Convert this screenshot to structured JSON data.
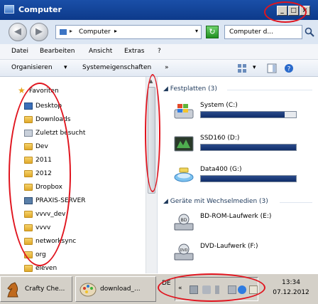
{
  "window": {
    "title": "Computer",
    "buttons": [
      "_",
      "□",
      "×"
    ]
  },
  "address": {
    "path": "Computer",
    "chevron": "▸",
    "search_value": "Computer d..."
  },
  "menu": [
    "Datei",
    "Bearbeiten",
    "Ansicht",
    "Extras",
    "?"
  ],
  "commands": {
    "organize": "Organisieren",
    "organize_arrow": "▾",
    "system_props": "Systemeigenschaften",
    "more": "»"
  },
  "nav": {
    "favorites_label": "Favoriten",
    "items": [
      {
        "label": "Desktop",
        "icon": "desktop-icon"
      },
      {
        "label": "Downloads",
        "icon": "folder-icon"
      },
      {
        "label": "Zuletzt besucht",
        "icon": "recent-icon"
      },
      {
        "label": "Dev",
        "icon": "folder-icon"
      },
      {
        "label": "2011",
        "icon": "folder-icon"
      },
      {
        "label": "2012",
        "icon": "folder-icon"
      },
      {
        "label": "Dropbox",
        "icon": "folder-icon"
      },
      {
        "label": "PRAXIS-SERVER",
        "icon": "server-icon"
      },
      {
        "label": "vvvv_dev",
        "icon": "folder-icon"
      },
      {
        "label": "vvvv",
        "icon": "folder-icon"
      },
      {
        "label": "networksync",
        "icon": "folder-icon"
      },
      {
        "label": "org",
        "icon": "folder-icon"
      },
      {
        "label": "eleven",
        "icon": "folder-icon"
      }
    ]
  },
  "content": {
    "hard_disks_header": "Festplatten (3)",
    "drives": [
      {
        "name": "System (C:)",
        "fill": 0.88
      },
      {
        "name": "SSD160 (D:)",
        "fill": 1.0
      },
      {
        "name": "Data400 (G:)",
        "fill": 1.0
      }
    ],
    "removable_header": "Geräte mit Wechselmedien (3)",
    "removable": [
      {
        "name": "BD-ROM-Laufwerk (E:)"
      },
      {
        "name": "DVD-Laufwerk (F:)"
      }
    ]
  },
  "taskbar": {
    "buttons": [
      {
        "label": "Crafty Che..."
      },
      {
        "label": "download_..."
      }
    ],
    "language": "DE",
    "tray_expand": "«",
    "time": "13:34",
    "date": "07.12.2012"
  },
  "colors": {
    "titlebar": "#1a4fa8",
    "drive_fill": "#0f2d6a",
    "annotation": "#e0141e"
  }
}
